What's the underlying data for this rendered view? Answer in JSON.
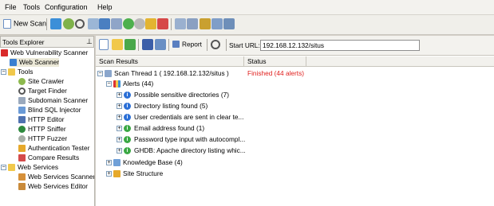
{
  "menubar": {
    "items": [
      "File",
      "Tools",
      "Configuration",
      "Help"
    ]
  },
  "toolbar": {
    "new_scan_label": "New Scan"
  },
  "tools_explorer": {
    "title": "Tools Explorer",
    "pin": "⊥",
    "items": [
      "Web Vulnerability Scanner",
      "Web Scanner",
      "Tools",
      "Site Crawler",
      "Target Finder",
      "Subdomain Scanner",
      "Blind SQL Injector",
      "HTTP Editor",
      "HTTP Sniffer",
      "HTTP Fuzzer",
      "Authentication Tester",
      "Compare Results",
      "Web Services",
      "Web Services Scanner",
      "Web Services Editor"
    ]
  },
  "scan_toolbar": {
    "report_label": "Report",
    "start_url_label": "Start URL:",
    "start_url_value": "192.168.12.132/situs"
  },
  "results": {
    "columns": [
      "Scan Results",
      "Status"
    ],
    "thread": {
      "label": "Scan Thread 1 ( 192.168.12.132/situs )",
      "status": "Finished (44 alerts)"
    },
    "alerts_label": "Alerts (44)",
    "alerts": [
      "Possible sensitive directories (7)",
      "Directory listing found (5)",
      "User credentials are sent in clear te...",
      "Email address found (1)",
      "Password type input with autocompl...",
      "GHDB: Apache directory listing whic..."
    ],
    "knowledge_base": "Knowledge Base (4)",
    "site_structure": "Site Structure"
  },
  "colors": {
    "status_red": "#e0201e",
    "info_blue": "#2b6fd6",
    "info_green": "#3aa844",
    "selection_bg": "#ece9d8"
  }
}
